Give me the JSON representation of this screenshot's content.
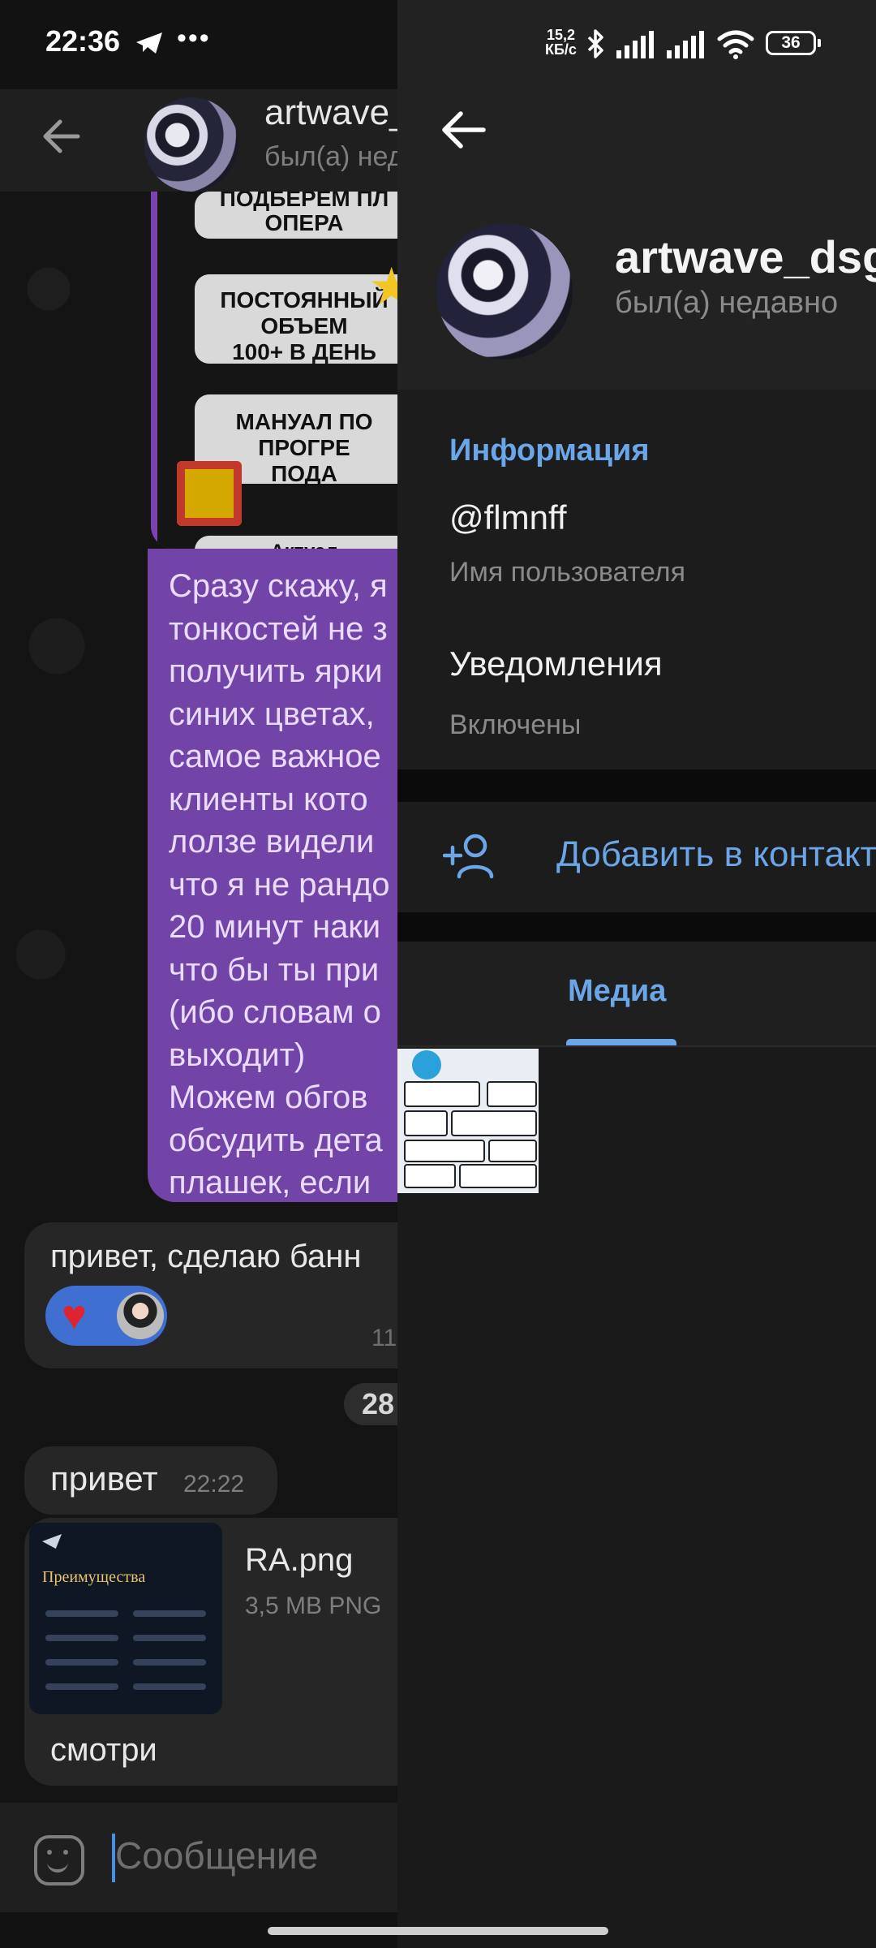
{
  "status_bar": {
    "time": "22:36",
    "net_speed_value": "15,2",
    "net_speed_unit": "КБ/с",
    "battery": "36",
    "left_icons": [
      "telegram-icon",
      "more-dots-icon"
    ],
    "right_icons": [
      "bluetooth-icon",
      "signal-icon",
      "signal-icon",
      "wifi-icon",
      "battery-icon"
    ]
  },
  "chat": {
    "header": {
      "title": "artwave_dsgn",
      "subtitle": "был(а) недавно"
    },
    "promo_pills": [
      "ПОДБЕРЕМ ПЛ\nОПЕРА",
      "ПОСТОЯННЫЙ ОБЪЕМ\n100+ В ДЕНЬ",
      "МАНУАЛ ПО ПРОГРЕ\nПОДА",
      "Актуал"
    ],
    "purple_message": "Сразу скажу, я\nтонкостей не з\nполучить ярки\nсиних цветах,\nсамое важное\nклиенты кото\nлолзе видели\nчто я не рандо\n20 минут наки\nчто бы ты при\n(ибо словам о\nвыходит)\nМожем обгов\nобсудить дета\nплашек, если",
    "reply_message": "привет, сделаю банн",
    "reply_time": "11",
    "date_chip": "28",
    "greeting_message": "привет",
    "greeting_time": "22:22",
    "file": {
      "name": "RA.png",
      "meta": "3,5 MB PNG",
      "thumb_title": "Преимущества"
    },
    "caption": "смотри",
    "input_placeholder": "Сообщение"
  },
  "profile": {
    "name": "artwave_dsgn",
    "status": "был(а) недавно",
    "info_section_title": "Информация",
    "username": "@flmnff",
    "username_label": "Имя пользователя",
    "notifications_title": "Уведомления",
    "notifications_value": "Включены",
    "add_contact_label": "Добавить в контакт",
    "tab_media": "Медиа"
  },
  "colors": {
    "accent_blue": "#6aa6e8",
    "purple_bubble": "#7344a8",
    "reaction_blue": "#3f6fd1"
  }
}
